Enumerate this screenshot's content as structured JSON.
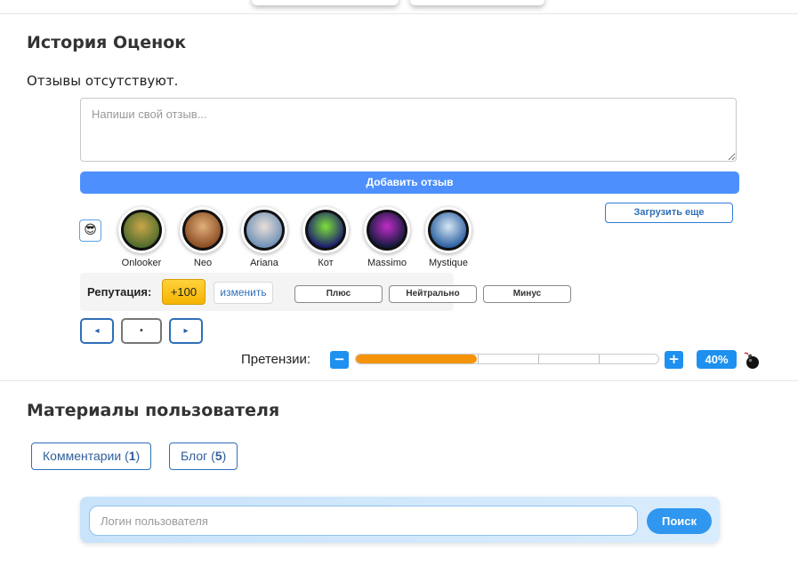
{
  "ratings_section": {
    "title": "История Оценок",
    "empty_text": "Отзывы отсутствуют.",
    "review_placeholder": "Напиши свой отзыв...",
    "add_review_label": "Добавить отзыв",
    "load_more_label": "Загрузить еще",
    "emoji_icon": "😎",
    "users": [
      {
        "name": "Onlooker",
        "avatar_colors": [
          "#4e6b2c",
          "#c9a64a"
        ]
      },
      {
        "name": "Neo",
        "avatar_colors": [
          "#8a4b22",
          "#e1b07a"
        ]
      },
      {
        "name": "Ariana",
        "avatar_colors": [
          "#6d8fb8",
          "#e9dfd7"
        ]
      },
      {
        "name": "Кот",
        "avatar_colors": [
          "#1a1a6e",
          "#7de03a"
        ]
      },
      {
        "name": "Massimo",
        "avatar_colors": [
          "#101a3a",
          "#c02cc9"
        ]
      },
      {
        "name": "Mystique",
        "avatar_colors": [
          "#2a5fa0",
          "#d6e7f5"
        ]
      }
    ],
    "reputation": {
      "label": "Репутация:",
      "value": "+100",
      "change_label": "изменить",
      "votes": [
        "Плюс",
        "Нейтрально",
        "Минус"
      ]
    },
    "pager": {
      "prev_icon": "◂",
      "current": "•",
      "next_icon": "▸"
    },
    "claims": {
      "label": "Претензии:",
      "minus_icon": "−",
      "plus_icon": "+",
      "progress_fraction": 0.4,
      "percent_label": "40%",
      "bomb_icon": "bomb-icon"
    }
  },
  "materials_section": {
    "title": "Материалы пользователя",
    "tabs": [
      {
        "label": "Комментарии (",
        "count": "1",
        "suffix": ")"
      },
      {
        "label": "Блог (",
        "count": "5",
        "suffix": ")"
      }
    ]
  },
  "search": {
    "placeholder": "Логин пользователя",
    "button_label": "Поиск"
  },
  "colors": {
    "accent": "#4d90fd",
    "claims_fill": "#f5940a",
    "reputation_badge": "#ffc81e",
    "search_button": "#2f97ef"
  }
}
